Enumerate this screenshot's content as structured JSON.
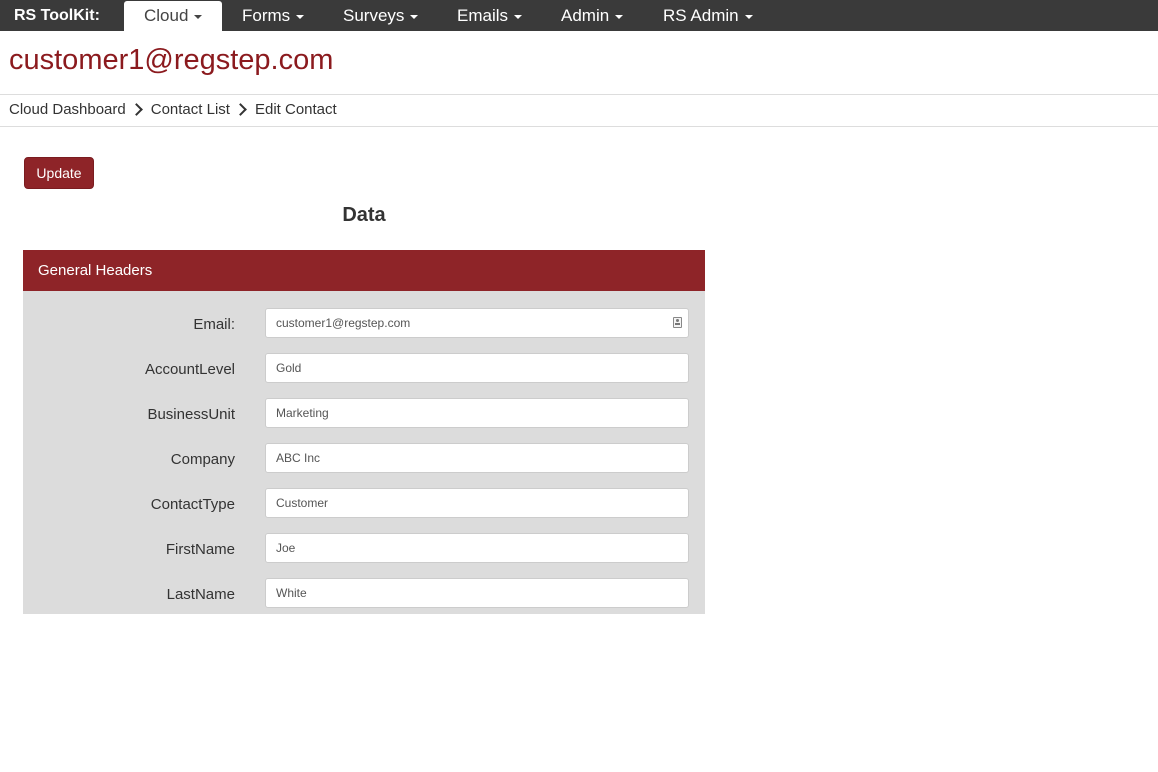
{
  "navbar": {
    "brand": "RS ToolKit:",
    "items": [
      {
        "label": "Cloud",
        "active": true
      },
      {
        "label": "Forms",
        "active": false
      },
      {
        "label": "Surveys",
        "active": false
      },
      {
        "label": "Emails",
        "active": false
      },
      {
        "label": "Admin",
        "active": false
      },
      {
        "label": "RS Admin",
        "active": false
      }
    ]
  },
  "page": {
    "title": "customer1@regstep.com"
  },
  "breadcrumb": [
    "Cloud Dashboard",
    "Contact List",
    "Edit Contact"
  ],
  "toolbar": {
    "update_label": "Update"
  },
  "section": {
    "title": "Data"
  },
  "panel": {
    "heading": "General Headers",
    "fields": [
      {
        "label": "Email:",
        "value": "customer1@regstep.com"
      },
      {
        "label": "AccountLevel",
        "value": "Gold"
      },
      {
        "label": "BusinessUnit",
        "value": "Marketing"
      },
      {
        "label": "Company",
        "value": "ABC Inc"
      },
      {
        "label": "ContactType",
        "value": "Customer"
      },
      {
        "label": "FirstName",
        "value": "Joe"
      },
      {
        "label": "LastName",
        "value": "White"
      }
    ]
  },
  "colors": {
    "brand_red": "#8e2428",
    "title_red": "#8b1a1e",
    "navbar_bg": "#3a3a3a",
    "panel_bg": "#dcdcdc"
  },
  "icons": {
    "email_field_icon": "contact-card-icon",
    "breadcrumb_separator": "chevron-right-icon",
    "nav_dropdown": "caret-down-icon"
  }
}
